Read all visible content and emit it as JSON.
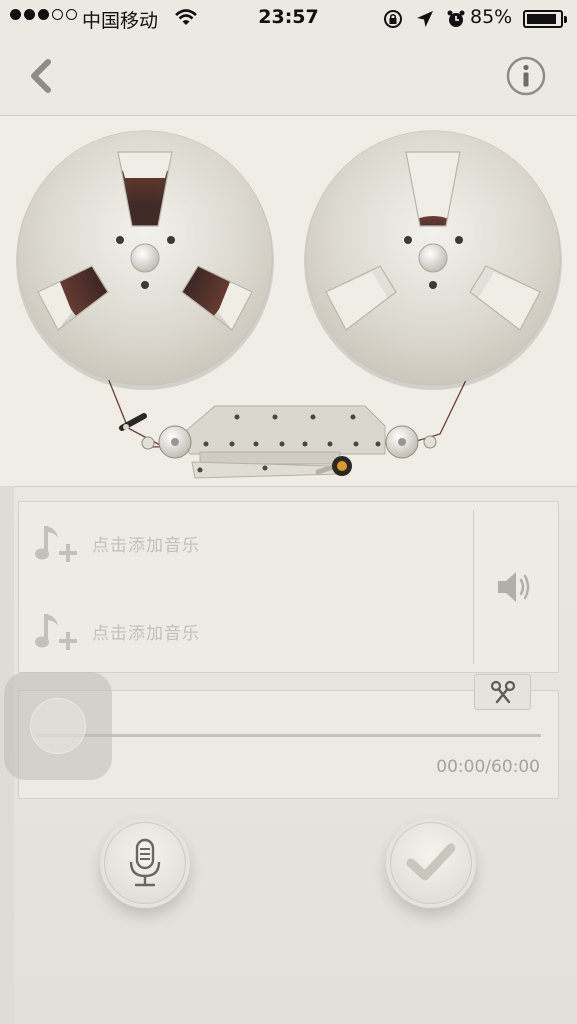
{
  "status_bar": {
    "carrier": "中国移动",
    "time": "23:57",
    "battery_percent": "85%",
    "battery_level": 0.85,
    "signal_bars_filled": 3,
    "signal_bars_total": 5
  },
  "nav": {
    "back_icon": "chevron-left-icon",
    "info_icon": "info-icon"
  },
  "music_tracks": [
    {
      "label": "点击添加音乐",
      "icon": "add-music-icon"
    },
    {
      "label": "点击添加音乐",
      "icon": "add-music-icon"
    }
  ],
  "volume_icon": "speaker-icon",
  "trim_icon": "scissors-icon",
  "progress": {
    "time": "00:00/60:00",
    "fraction": 0
  },
  "actions": {
    "record_icon": "microphone-icon",
    "done_icon": "checkmark-icon"
  },
  "colors": {
    "background": "#e6e4dd",
    "reel_metal": "#d8d5cc",
    "tape": "#3b1c16",
    "placeholder_text": "#c3c1ba"
  }
}
